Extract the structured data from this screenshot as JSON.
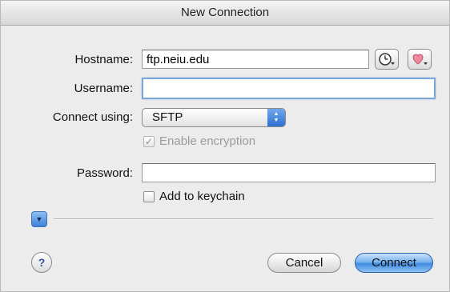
{
  "window": {
    "title": "New Connection"
  },
  "form": {
    "hostname_label": "Hostname:",
    "hostname_value": "ftp.neiu.edu",
    "username_label": "Username:",
    "username_value": "",
    "connect_using_label": "Connect using:",
    "connect_using_value": "SFTP",
    "enable_encryption_label": "Enable encryption",
    "enable_encryption_checked": true,
    "password_label": "Password:",
    "password_value": "",
    "add_keychain_label": "Add to keychain",
    "add_keychain_checked": false
  },
  "buttons": {
    "cancel_label": "Cancel",
    "connect_label": "Connect",
    "help_label": "?"
  },
  "icons": {
    "history": "clock-icon",
    "bookmarks": "heart-icon",
    "disclosure": "disclosure-triangle-icon",
    "help": "help-icon"
  },
  "colors": {
    "accent_blue": "#3f8be0",
    "focus_ring": "#7ba7d6",
    "bookmark_heart": "#e86a86"
  }
}
